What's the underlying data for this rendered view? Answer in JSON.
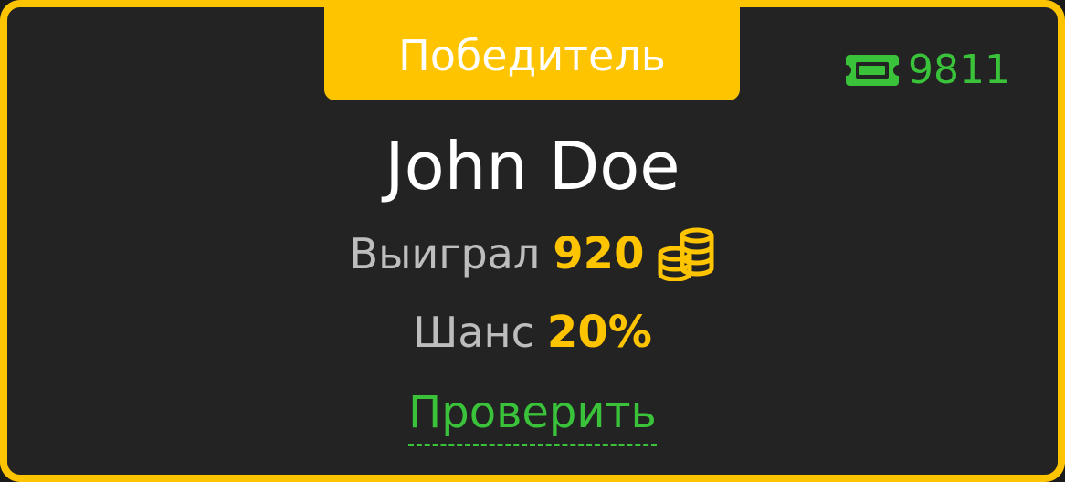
{
  "card": {
    "title": "Победитель",
    "tickets": "9811"
  },
  "player": {
    "name": "John Doe"
  },
  "stats": {
    "won_label": "Выиграл",
    "won_value": "920",
    "chance_label": "Шанс",
    "chance_value": "20%"
  },
  "actions": {
    "verify_label": "Проверить"
  },
  "icons": {
    "tickets": "ticket-icon",
    "coins": "coins-stack-icon"
  },
  "colors": {
    "accent": "#ffc400",
    "success": "#39c23a",
    "background": "#232323",
    "muted_text": "#bdbdbd"
  }
}
